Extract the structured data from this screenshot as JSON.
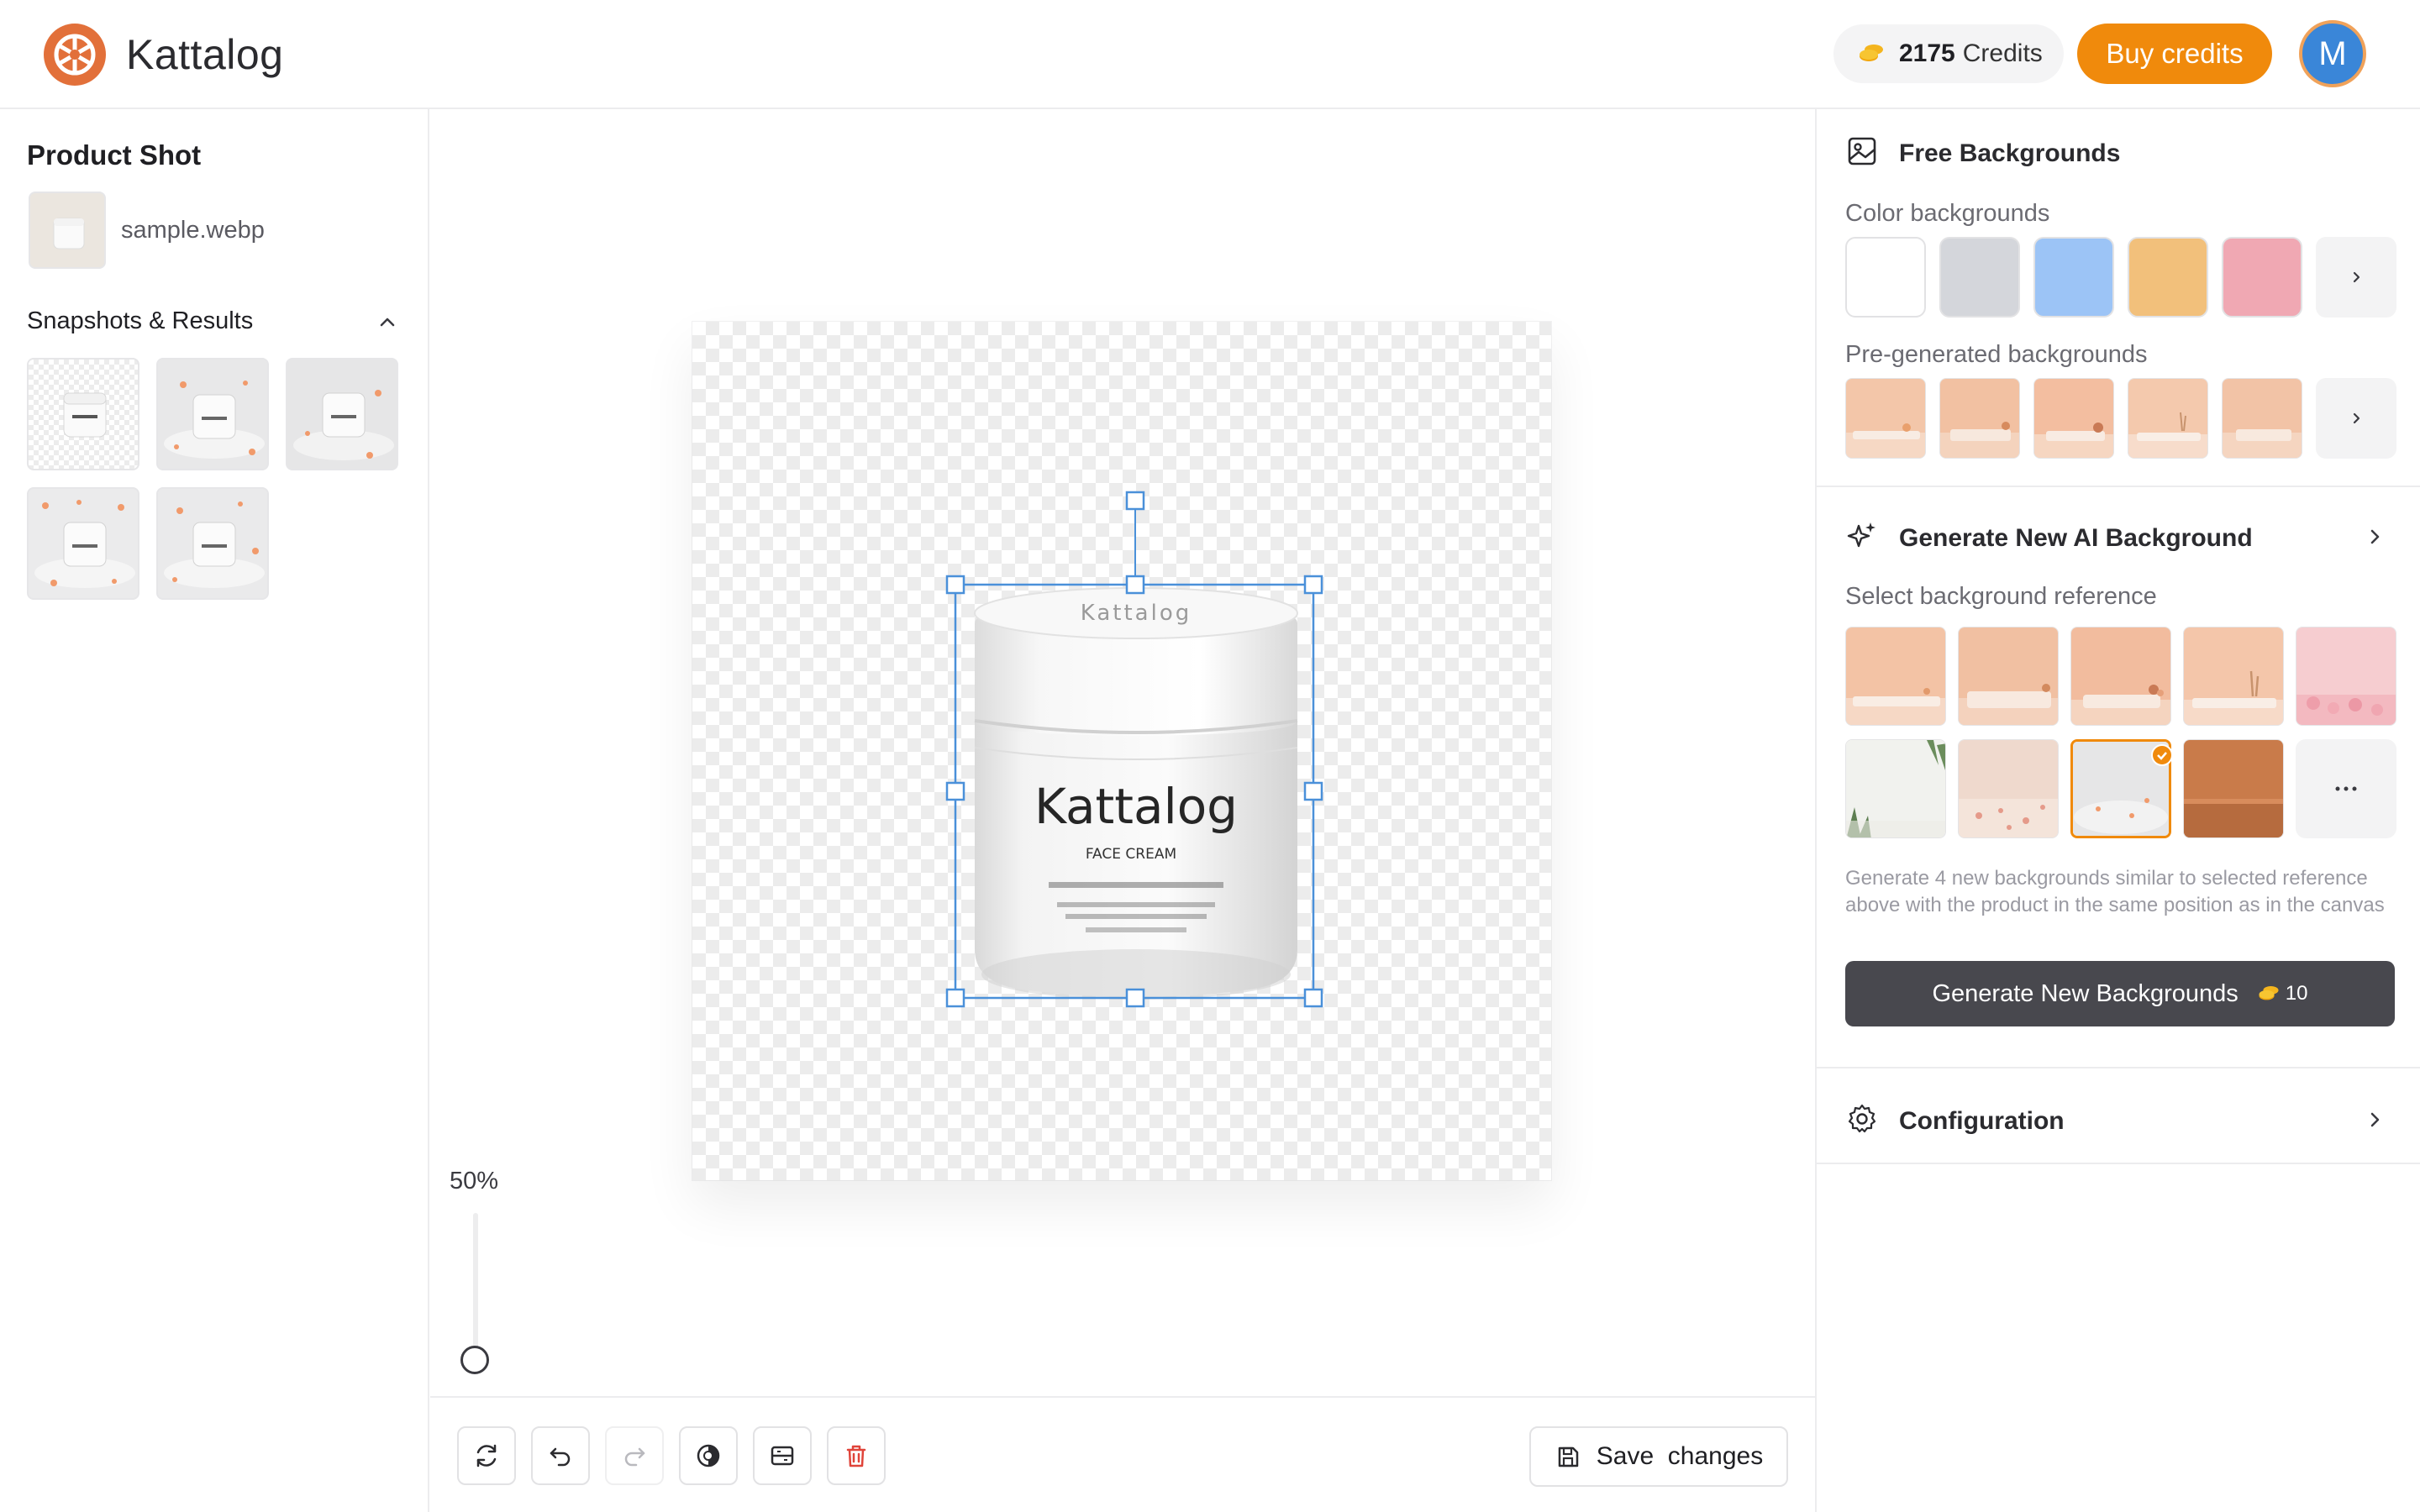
{
  "header": {
    "brand": "Kattalog",
    "credits_value": "2175",
    "credits_label": "Credits",
    "buy_label": "Buy credits",
    "avatar_initial": "M"
  },
  "left": {
    "section_title": "Product Shot",
    "file_name": "sample.webp",
    "snapshots_title": "Snapshots & Results",
    "snapshot_count": 5,
    "selected_snapshot_index": 0
  },
  "canvas": {
    "product_text": {
      "lid": "Kattalog",
      "brand": "Kattalog",
      "type": "FACE CREAM"
    },
    "zoom_label": "50%"
  },
  "toolbar": {
    "tools": [
      "rotate-icon",
      "undo-icon",
      "redo-icon",
      "contrast-icon",
      "crop-icon",
      "trash-icon"
    ],
    "save_label": "Save  changes"
  },
  "right": {
    "free_title": "Free Backgrounds",
    "color_label": "Color backgrounds",
    "colors": [
      "#ffffff",
      "#d4d6db",
      "#9cc4f6",
      "#f2c07b",
      "#f0a8b3"
    ],
    "pregen_label": "Pre-generated backgrounds",
    "ai_title": "Generate New AI Background",
    "ref_label": "Select background reference",
    "selected_ref_index": 7,
    "helper_text": "Generate 4 new backgrounds similar to selected reference above with the product in the same position as in the canvas",
    "gen_label": "Generate New Backgrounds",
    "gen_cost": "10",
    "config_title": "Configuration"
  },
  "accent": "#f08a0c"
}
